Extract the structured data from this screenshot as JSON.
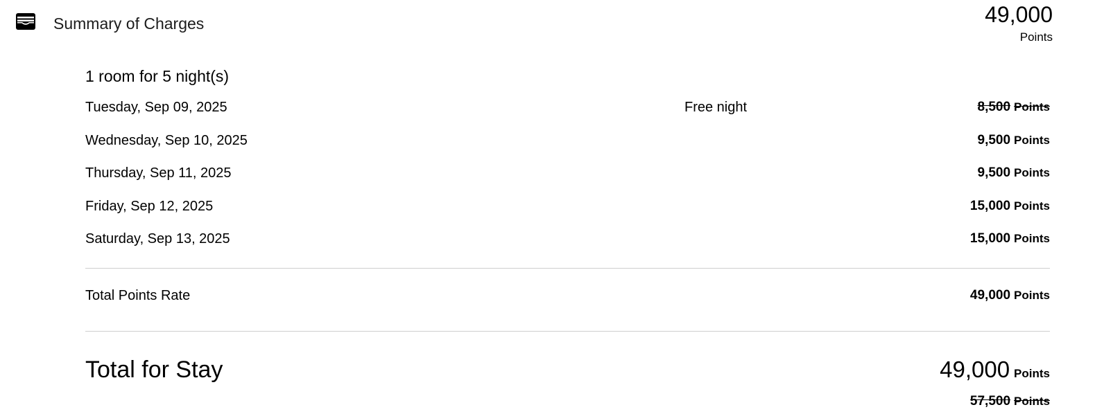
{
  "header": {
    "icon": "wallet-icon",
    "title": "Summary of Charges",
    "total_value": "49,000",
    "total_unit": "Points"
  },
  "stay": {
    "room_summary": "1 room for 5 night(s)",
    "nights": [
      {
        "date": "Tuesday, Sep 09, 2025",
        "note": "Free night",
        "amount": "8,500",
        "unit": "Points",
        "struck": true
      },
      {
        "date": "Wednesday, Sep 10, 2025",
        "note": "",
        "amount": "9,500",
        "unit": "Points",
        "struck": false
      },
      {
        "date": "Thursday, Sep 11, 2025",
        "note": "",
        "amount": "9,500",
        "unit": "Points",
        "struck": false
      },
      {
        "date": "Friday, Sep 12, 2025",
        "note": "",
        "amount": "15,000",
        "unit": "Points",
        "struck": false
      },
      {
        "date": "Saturday, Sep 13, 2025",
        "note": "",
        "amount": "15,000",
        "unit": "Points",
        "struck": false
      }
    ]
  },
  "total_points_rate": {
    "label": "Total Points Rate",
    "amount": "49,000",
    "unit": "Points"
  },
  "total_for_stay": {
    "label": "Total for Stay",
    "amount": "49,000",
    "unit": "Points",
    "original_amount": "57,500",
    "original_unit": "Points"
  },
  "colors": {
    "text": "#000000",
    "divider": "#cfcfcf"
  }
}
